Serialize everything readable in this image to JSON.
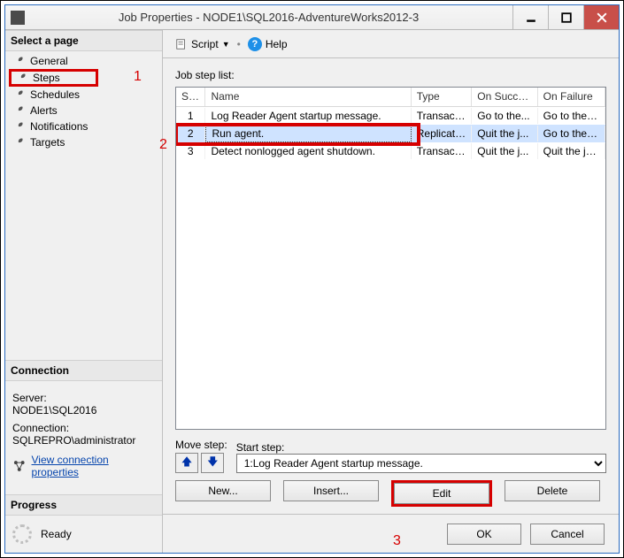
{
  "window": {
    "title": "Job Properties - NODE1\\SQL2016-AdventureWorks2012-3"
  },
  "annotations": {
    "a1": "1",
    "a2": "2",
    "a3": "3"
  },
  "sidebar": {
    "select_page_header": "Select a page",
    "pages": {
      "general": "General",
      "steps": "Steps",
      "schedules": "Schedules",
      "alerts": "Alerts",
      "notifications": "Notifications",
      "targets": "Targets"
    },
    "connection_header": "Connection",
    "server_label": "Server:",
    "server_value": "NODE1\\SQL2016",
    "connection_label": "Connection:",
    "connection_value": "SQLREPRO\\administrator",
    "view_conn_props": "View connection properties",
    "progress_header": "Progress",
    "progress_status": "Ready"
  },
  "toolbar": {
    "script": "Script",
    "help": "Help"
  },
  "main": {
    "list_caption": "Job step list:",
    "columns": {
      "step": "St...",
      "name": "Name",
      "type": "Type",
      "on_success": "On Success",
      "on_failure": "On Failure"
    },
    "rows": [
      {
        "step": "1",
        "name": "Log Reader Agent startup message.",
        "type": "Transact-...",
        "on_success": "Go to the...",
        "on_failure": "Go to the n..."
      },
      {
        "step": "2",
        "name": "Run agent.",
        "type": "Replicati...",
        "on_success": "Quit the j...",
        "on_failure": "Go to the n..."
      },
      {
        "step": "3",
        "name": "Detect nonlogged agent shutdown.",
        "type": "Transact-...",
        "on_success": "Quit the j...",
        "on_failure": "Quit the job..."
      }
    ],
    "move_step_label": "Move step:",
    "start_step_label": "Start step:",
    "start_step_value": "1:Log Reader Agent startup message.",
    "buttons": {
      "new": "New...",
      "insert": "Insert...",
      "edit": "Edit",
      "delete": "Delete"
    }
  },
  "footer": {
    "ok": "OK",
    "cancel": "Cancel"
  }
}
